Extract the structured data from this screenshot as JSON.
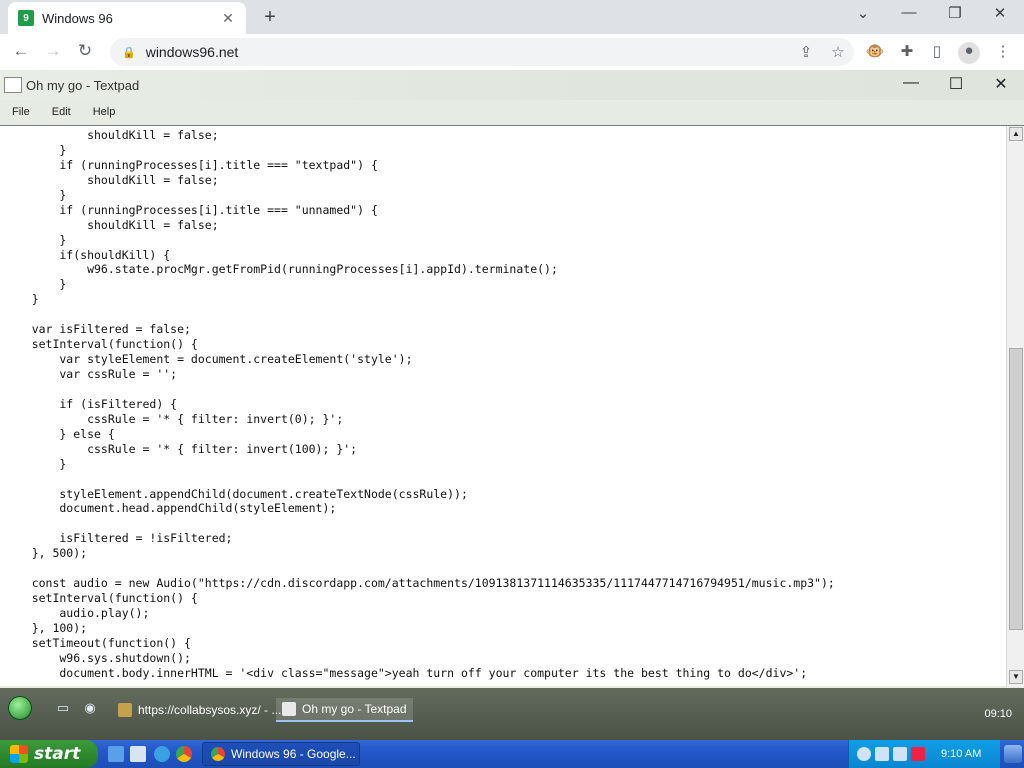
{
  "browser": {
    "tab_title": "Windows 96",
    "tab_close": "✕",
    "new_tab": "+",
    "url": "windows96.net",
    "window_controls": {
      "dropdown": "⌄",
      "minimize": "—",
      "restore": "❐",
      "close": "✕"
    },
    "icons": [
      "back-arrow-icon",
      "forward-arrow-icon",
      "reload-icon",
      "lock-icon",
      "share-icon",
      "bookmark-star-icon",
      "extension-monkey-icon",
      "puzzle-icon",
      "sidepanel-icon",
      "profile-icon",
      "kebab-menu-icon"
    ]
  },
  "textpad": {
    "title": "Oh my go - Textpad",
    "menu": [
      "File",
      "Edit",
      "Help"
    ],
    "code_lines": [
      "            shouldKill = false;",
      "        }",
      "        if (runningProcesses[i].title === \"textpad\") {",
      "            shouldKill = false;",
      "        }",
      "        if (runningProcesses[i].title === \"unnamed\") {",
      "            shouldKill = false;",
      "        }",
      "        if(shouldKill) {",
      "            w96.state.procMgr.getFromPid(runningProcesses[i].appId).terminate();",
      "        }",
      "    }",
      "",
      "    var isFiltered = false;",
      "    setInterval(function() {",
      "        var styleElement = document.createElement('style');",
      "        var cssRule = '';",
      "",
      "        if (isFiltered) {",
      "            cssRule = '* { filter: invert(0); }';",
      "        } else {",
      "            cssRule = '* { filter: invert(100); }';",
      "        }",
      "",
      "        styleElement.appendChild(document.createTextNode(cssRule));",
      "        document.head.appendChild(styleElement);",
      "",
      "        isFiltered = !isFiltered;",
      "    }, 500);",
      "",
      "    const audio = new Audio(\"https://cdn.discordapp.com/attachments/1091381371114635335/1117447714716794951/music.mp3\");",
      "    setInterval(function() {",
      "        audio.play();",
      "    }, 100);",
      "    setTimeout(function() {",
      "        w96.sys.shutdown();",
      "        document.body.innerHTML = '<div class=\"message\">yeah turn off your computer its the best thing to do</div>';"
    ]
  },
  "w96_taskbar": {
    "tasks": [
      {
        "label": "https://collabsysos.xyz/ - ..."
      },
      {
        "label": "Oh my go - Textpad"
      }
    ],
    "clock": "09:10"
  },
  "xp_taskbar": {
    "start_label": "start",
    "task_label": "Windows 96 - Google...",
    "clock": "9:10 AM"
  }
}
